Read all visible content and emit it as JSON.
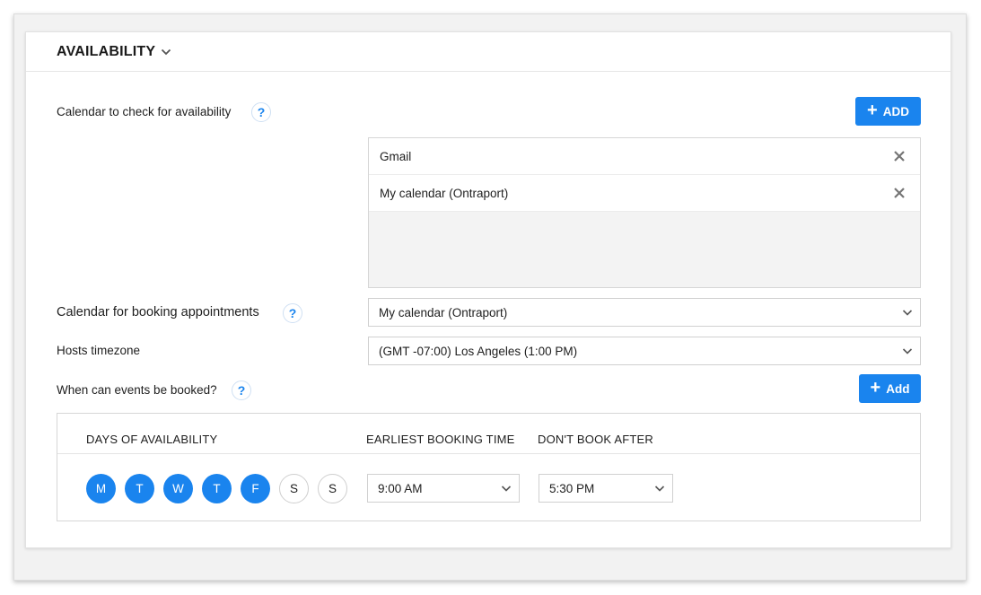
{
  "section": {
    "title": "AVAILABILITY"
  },
  "calendar_check": {
    "label": "Calendar to check for availability",
    "help": "?",
    "add_label": "ADD",
    "items": [
      "Gmail",
      "My calendar (Ontraport)"
    ]
  },
  "booking_calendar": {
    "label": "Calendar for booking appointments",
    "help": "?",
    "selected": "My calendar (Ontraport)"
  },
  "timezone": {
    "label": "Hosts timezone",
    "selected": "(GMT -07:00) Los Angeles (1:00 PM)"
  },
  "events": {
    "label": "When can events be booked?",
    "help": "?",
    "add_label": "Add"
  },
  "schedule": {
    "headers": {
      "days": "DAYS OF AVAILABILITY",
      "earliest": "EARLIEST BOOKING TIME",
      "dont_book_after": "DON'T BOOK AFTER"
    },
    "days": [
      {
        "label": "M",
        "selected": true
      },
      {
        "label": "T",
        "selected": true
      },
      {
        "label": "W",
        "selected": true
      },
      {
        "label": "T",
        "selected": true
      },
      {
        "label": "F",
        "selected": true
      },
      {
        "label": "S",
        "selected": false
      },
      {
        "label": "S",
        "selected": false
      }
    ],
    "earliest_time": "9:00 AM",
    "latest_time": "5:30 PM"
  },
  "colors": {
    "accent": "#1a84ee",
    "icon_gray": "#757575"
  },
  "icons": {
    "title_toggle": "chevron-down-icon",
    "remove": "close-icon",
    "add": "plus-icon",
    "help": "help-icon"
  }
}
